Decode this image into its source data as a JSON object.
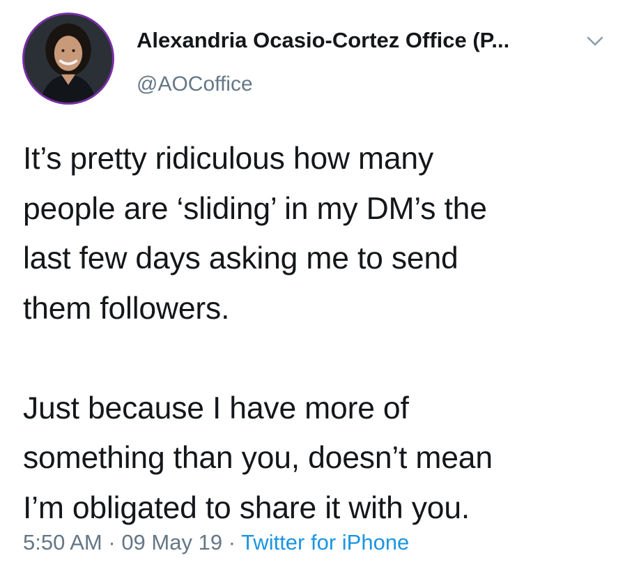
{
  "author": {
    "name": "Alexandria Ocasio-Cortez Office (P...",
    "handle": "@AOCoffice",
    "avatar_icon": "profile-photo",
    "menu_icon": "chevron-down-icon"
  },
  "tweet": {
    "paragraphs": [
      {
        "lines": [
          "It’s pretty ridiculous how many",
          "people are ‘sliding’ in my DM’s the",
          "last few days asking me to send",
          "them followers."
        ]
      },
      {
        "lines": [
          "Just because I have more of",
          "something than you, doesn’t mean",
          "I’m obligated to share it with you."
        ]
      }
    ]
  },
  "meta": {
    "time": "5:50 AM",
    "separator": " · ",
    "date": "09 May 19",
    "source": "Twitter for iPhone"
  },
  "colors": {
    "text": "#14171a",
    "secondary": "#657786",
    "link": "#1b95e0",
    "avatar_ring": "#7a2fa6"
  }
}
